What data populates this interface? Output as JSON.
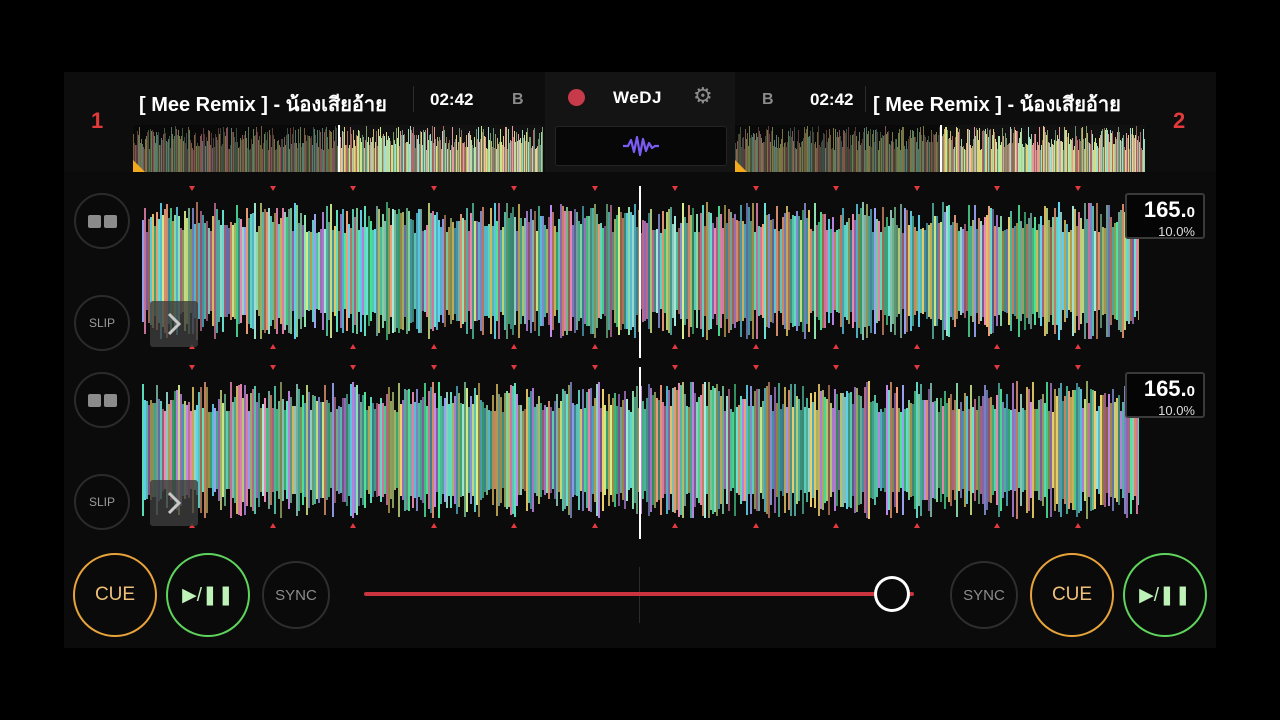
{
  "deck1": {
    "number": "1",
    "title": "[ Mee Remix ] - น้องเสียอ้าย",
    "time": "02:42",
    "key": "B",
    "bpm_main": "165.",
    "bpm_dec": "0",
    "pitch": "10.0%",
    "slip_label": "SLIP",
    "cue_label": "CUE",
    "play_label": "▶/❚❚",
    "sync_label": "SYNC"
  },
  "deck2": {
    "number": "2",
    "title": "[ Mee Remix ] - น้องเสียอ้าย",
    "time": "02:42",
    "key": "B",
    "bpm_main": "165.",
    "bpm_dec": "0",
    "pitch": "10.0%",
    "slip_label": "SLIP",
    "cue_label": "CUE",
    "play_label": "▶/❚❚",
    "sync_label": "SYNC"
  },
  "center": {
    "logo": "WeDJ",
    "record_icon": "record-icon",
    "settings_icon": "gear-icon",
    "waveform_icon": "waveform-icon"
  },
  "crossfader": {
    "position": 0.96
  },
  "colors": {
    "deck_number": "#e23a3a",
    "cue": "#e8a33a",
    "play": "#5fd45d",
    "crossfader": "#c9343e",
    "beat_marker": "#e2383f",
    "record": "#c73a4a",
    "waveform_logo": "#7b5cf5"
  }
}
